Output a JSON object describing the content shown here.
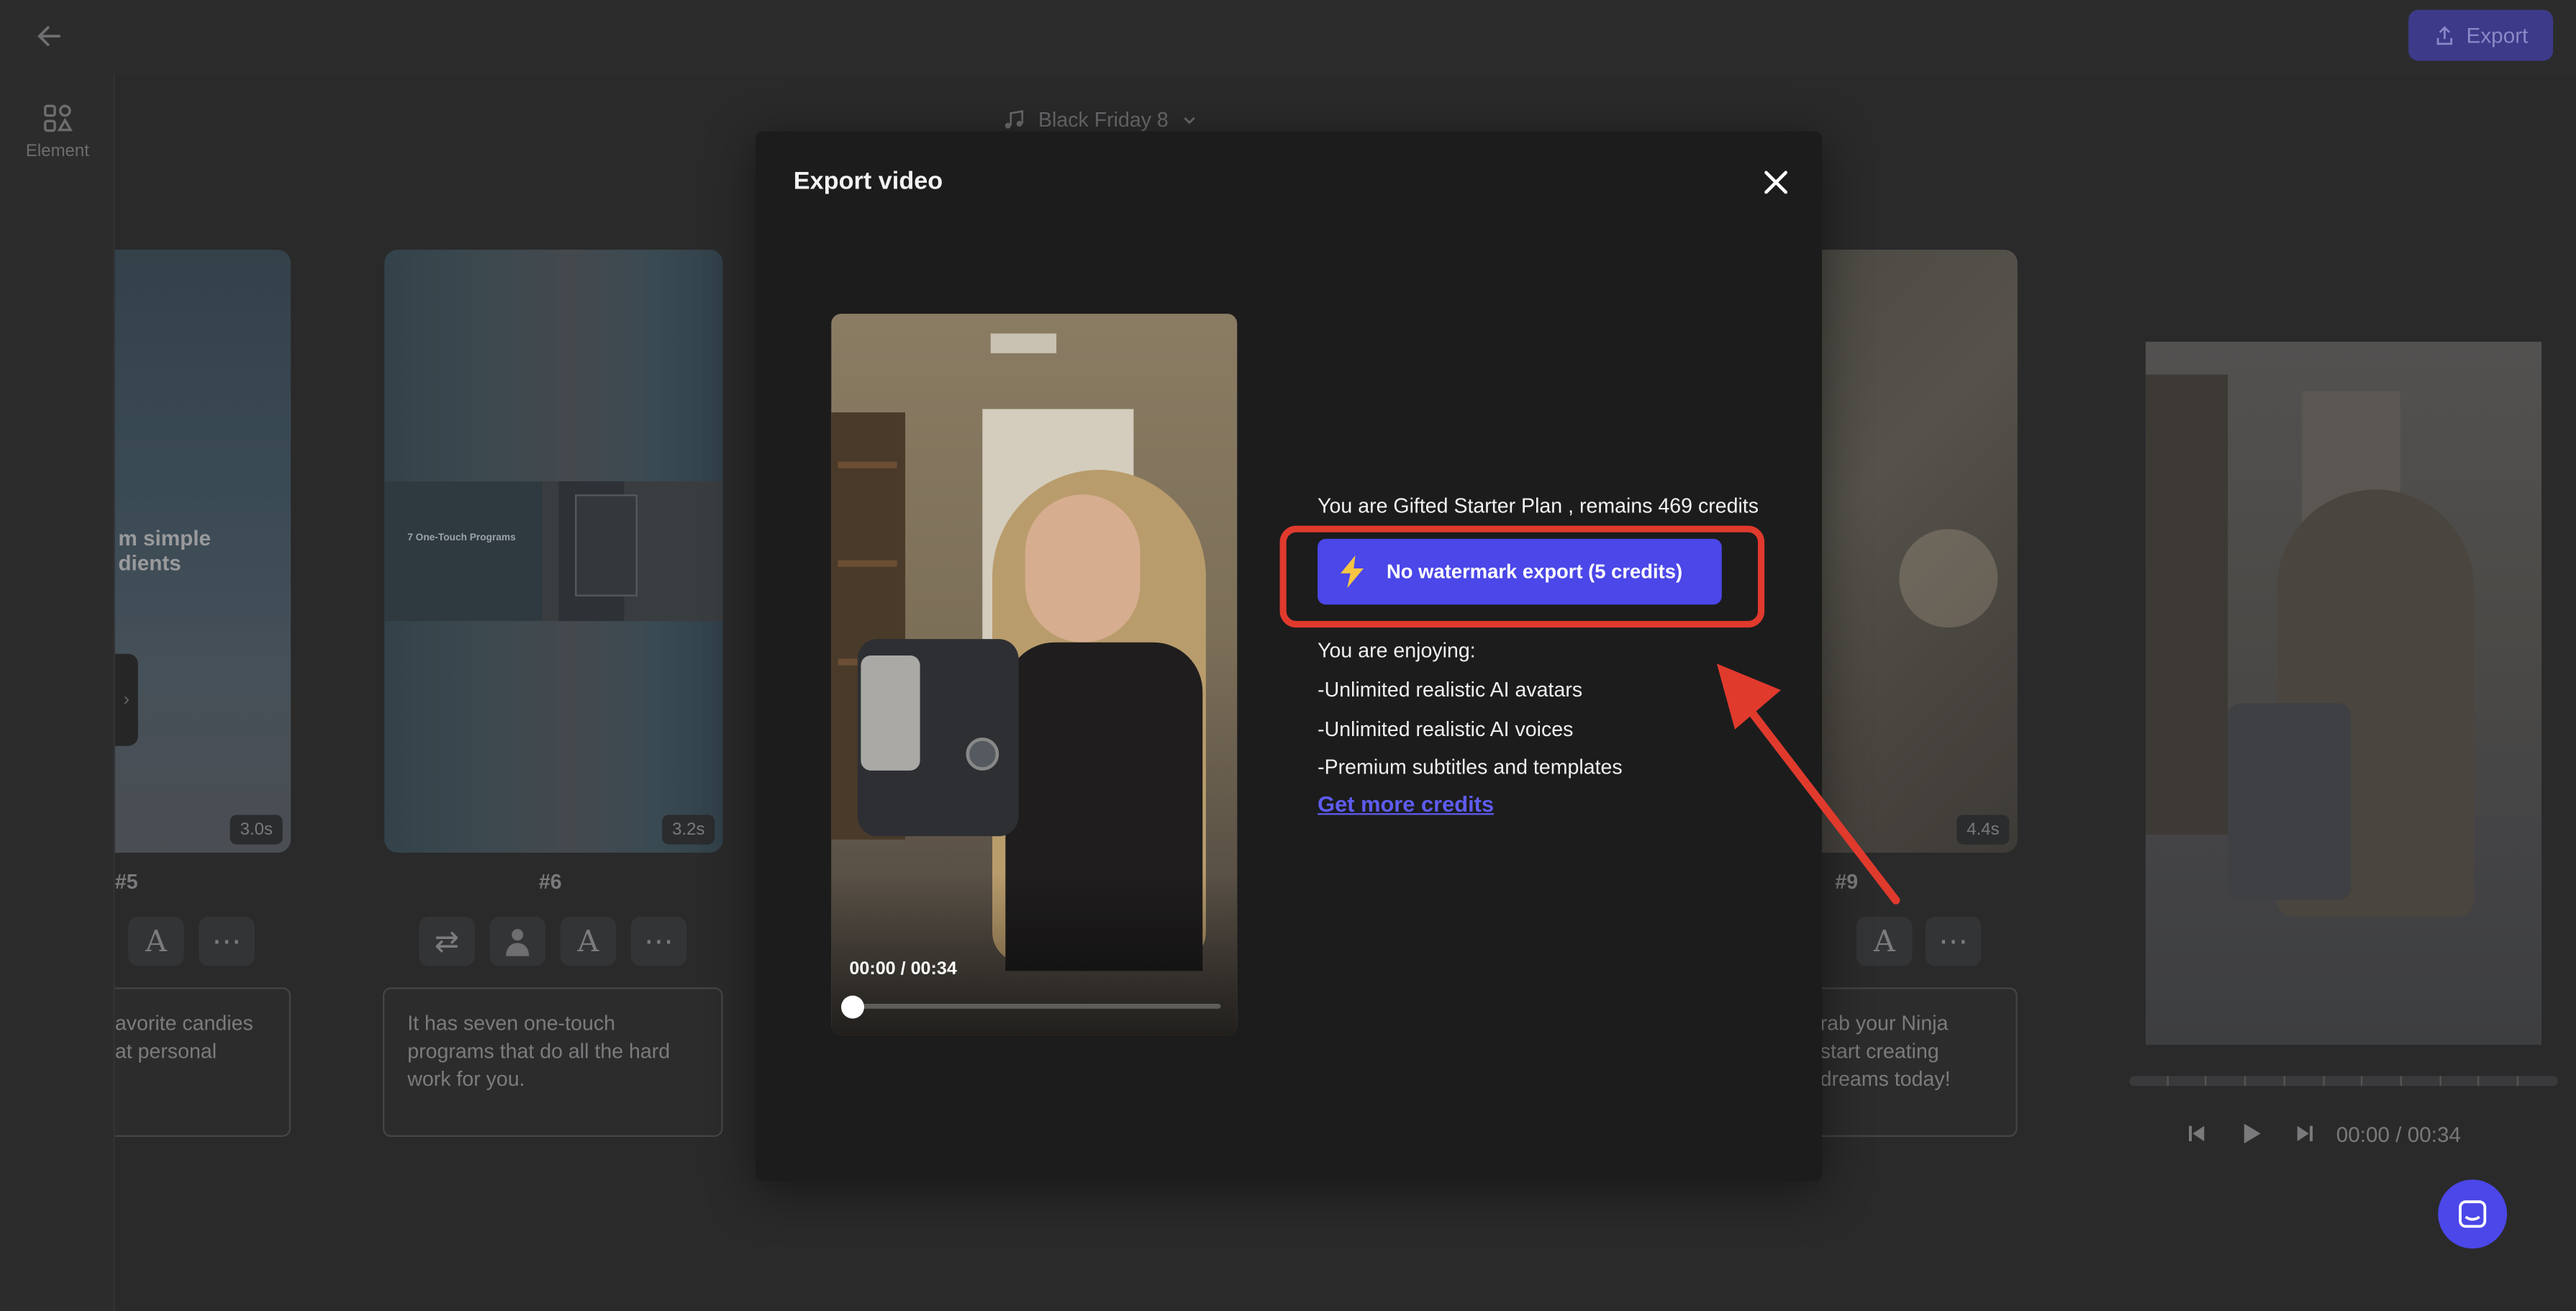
{
  "header": {
    "export_label": "Export"
  },
  "rail": {
    "element_label": "Element"
  },
  "music": {
    "track": "Black Friday 8"
  },
  "scenes": [
    {
      "number": "#5",
      "duration": "3.0s",
      "overlay_text": "m simple\ndients",
      "script": "avorite candies\nat personal"
    },
    {
      "number": "#6",
      "duration": "3.2s",
      "overlay_text": "7 One-Touch Programs",
      "script": "It has seven one-touch\nprograms that do all the hard\nwork for you."
    },
    {
      "number": "#9",
      "duration": "4.4s",
      "script": "rab your Ninja\n start creating\n dreams today!"
    }
  ],
  "player": {
    "time": "00:00 / 00:34"
  },
  "modal": {
    "title": "Export video",
    "video_time": "00:00 / 00:34",
    "plan_text": "You are Gifted Starter Plan , remains 469 credits",
    "no_watermark_label": "No watermark export (5 credits)",
    "enjoying_heading": "You are enjoying:",
    "benefits": [
      "-Unlimited realistic AI avatars",
      "-Unlimited realistic AI voices",
      "-Premium subtitles and templates"
    ],
    "get_more_credits": "Get more credits"
  },
  "colors": {
    "accent": "#4b47e8",
    "highlight": "#e03a2d",
    "modal_bg": "#1c1c1d"
  }
}
